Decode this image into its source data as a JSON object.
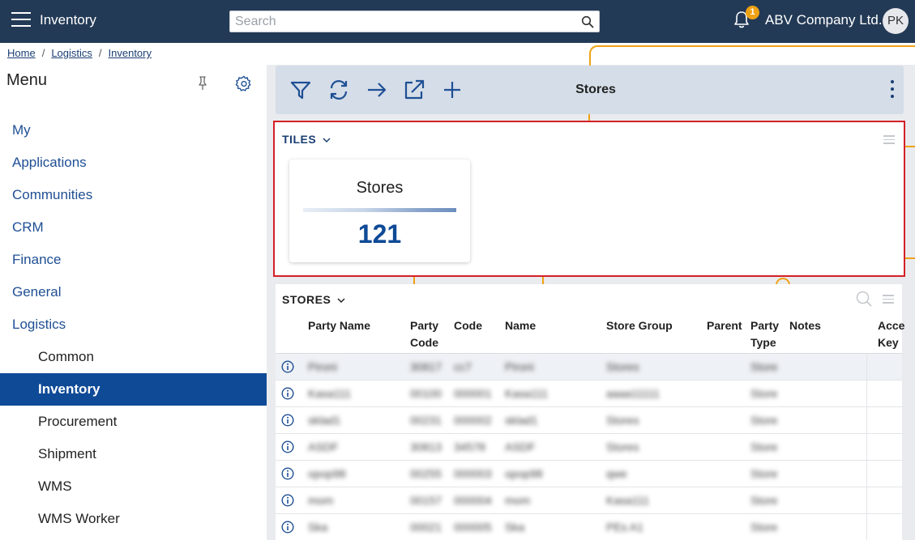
{
  "header": {
    "app_title": "Inventory",
    "search_placeholder": "Search",
    "notification_count": "1",
    "company": "ABV Company Ltd.",
    "avatar_initials": "PK"
  },
  "breadcrumb": [
    "Home",
    "Logistics",
    "Inventory"
  ],
  "sidebar": {
    "title": "Menu",
    "items": [
      {
        "label": "My",
        "level": 0
      },
      {
        "label": "Applications",
        "level": 0
      },
      {
        "label": "Communities",
        "level": 0
      },
      {
        "label": "CRM",
        "level": 0
      },
      {
        "label": "Finance",
        "level": 0
      },
      {
        "label": "General",
        "level": 0
      },
      {
        "label": "Logistics",
        "level": 0
      },
      {
        "label": "Common",
        "level": 1
      },
      {
        "label": "Inventory",
        "level": 1,
        "active": true
      },
      {
        "label": "Procurement",
        "level": 1
      },
      {
        "label": "Shipment",
        "level": 1
      },
      {
        "label": "WMS",
        "level": 1
      },
      {
        "label": "WMS Worker",
        "level": 1
      }
    ]
  },
  "toolbar": {
    "title": "Stores",
    "buttons": [
      "filter-icon",
      "refresh-icon",
      "arrow-right-icon",
      "external-link-icon",
      "plus-icon"
    ]
  },
  "tiles": {
    "section_label": "TILES",
    "tile": {
      "title": "Stores",
      "value": "121"
    }
  },
  "stores": {
    "section_label": "STORES",
    "columns": [
      {
        "line1": "",
        "line2": "Party Name"
      },
      {
        "line1": "Party",
        "line2": "Code"
      },
      {
        "line1": "",
        "line2": "Code"
      },
      {
        "line1": "",
        "line2": "Name"
      },
      {
        "line1": "",
        "line2": "Store Group"
      },
      {
        "line1": "",
        "line2": "Parent"
      },
      {
        "line1": "Party",
        "line2": "Type"
      },
      {
        "line1": "",
        "line2": "Notes"
      },
      {
        "line1": "Acce",
        "line2": "Key"
      }
    ],
    "rows": [
      [
        "Pironi",
        "30817",
        "cc7",
        "Pironi",
        "Stores",
        "",
        "Store",
        "",
        ""
      ],
      [
        "Kasa111",
        "00100",
        "000001",
        "Kasa111",
        "aaaa11111",
        "",
        "Store",
        "",
        ""
      ],
      [
        "sklad1",
        "00231",
        "000002",
        "sklad1",
        "Stores",
        "",
        "Store",
        "",
        ""
      ],
      [
        "ASDF",
        "30813",
        "34578",
        "ASDF",
        "Stores",
        "",
        "Store",
        "",
        ""
      ],
      [
        "opop98",
        "00255",
        "000003",
        "opop98",
        "qwe",
        "",
        "Store",
        "",
        ""
      ],
      [
        "mom",
        "00157",
        "000004",
        "mom",
        "Kasa111",
        "",
        "Store",
        "",
        ""
      ],
      [
        "Ska",
        "00021",
        "000005",
        "Ska",
        "PEs A1",
        "",
        "Store",
        "",
        ""
      ]
    ]
  },
  "colors": {
    "topbar": "#233a56",
    "accent": "#0e4a96",
    "highlight_border": "#d51f27",
    "orange_line": "#f0a215",
    "badge": "#f0a215"
  }
}
